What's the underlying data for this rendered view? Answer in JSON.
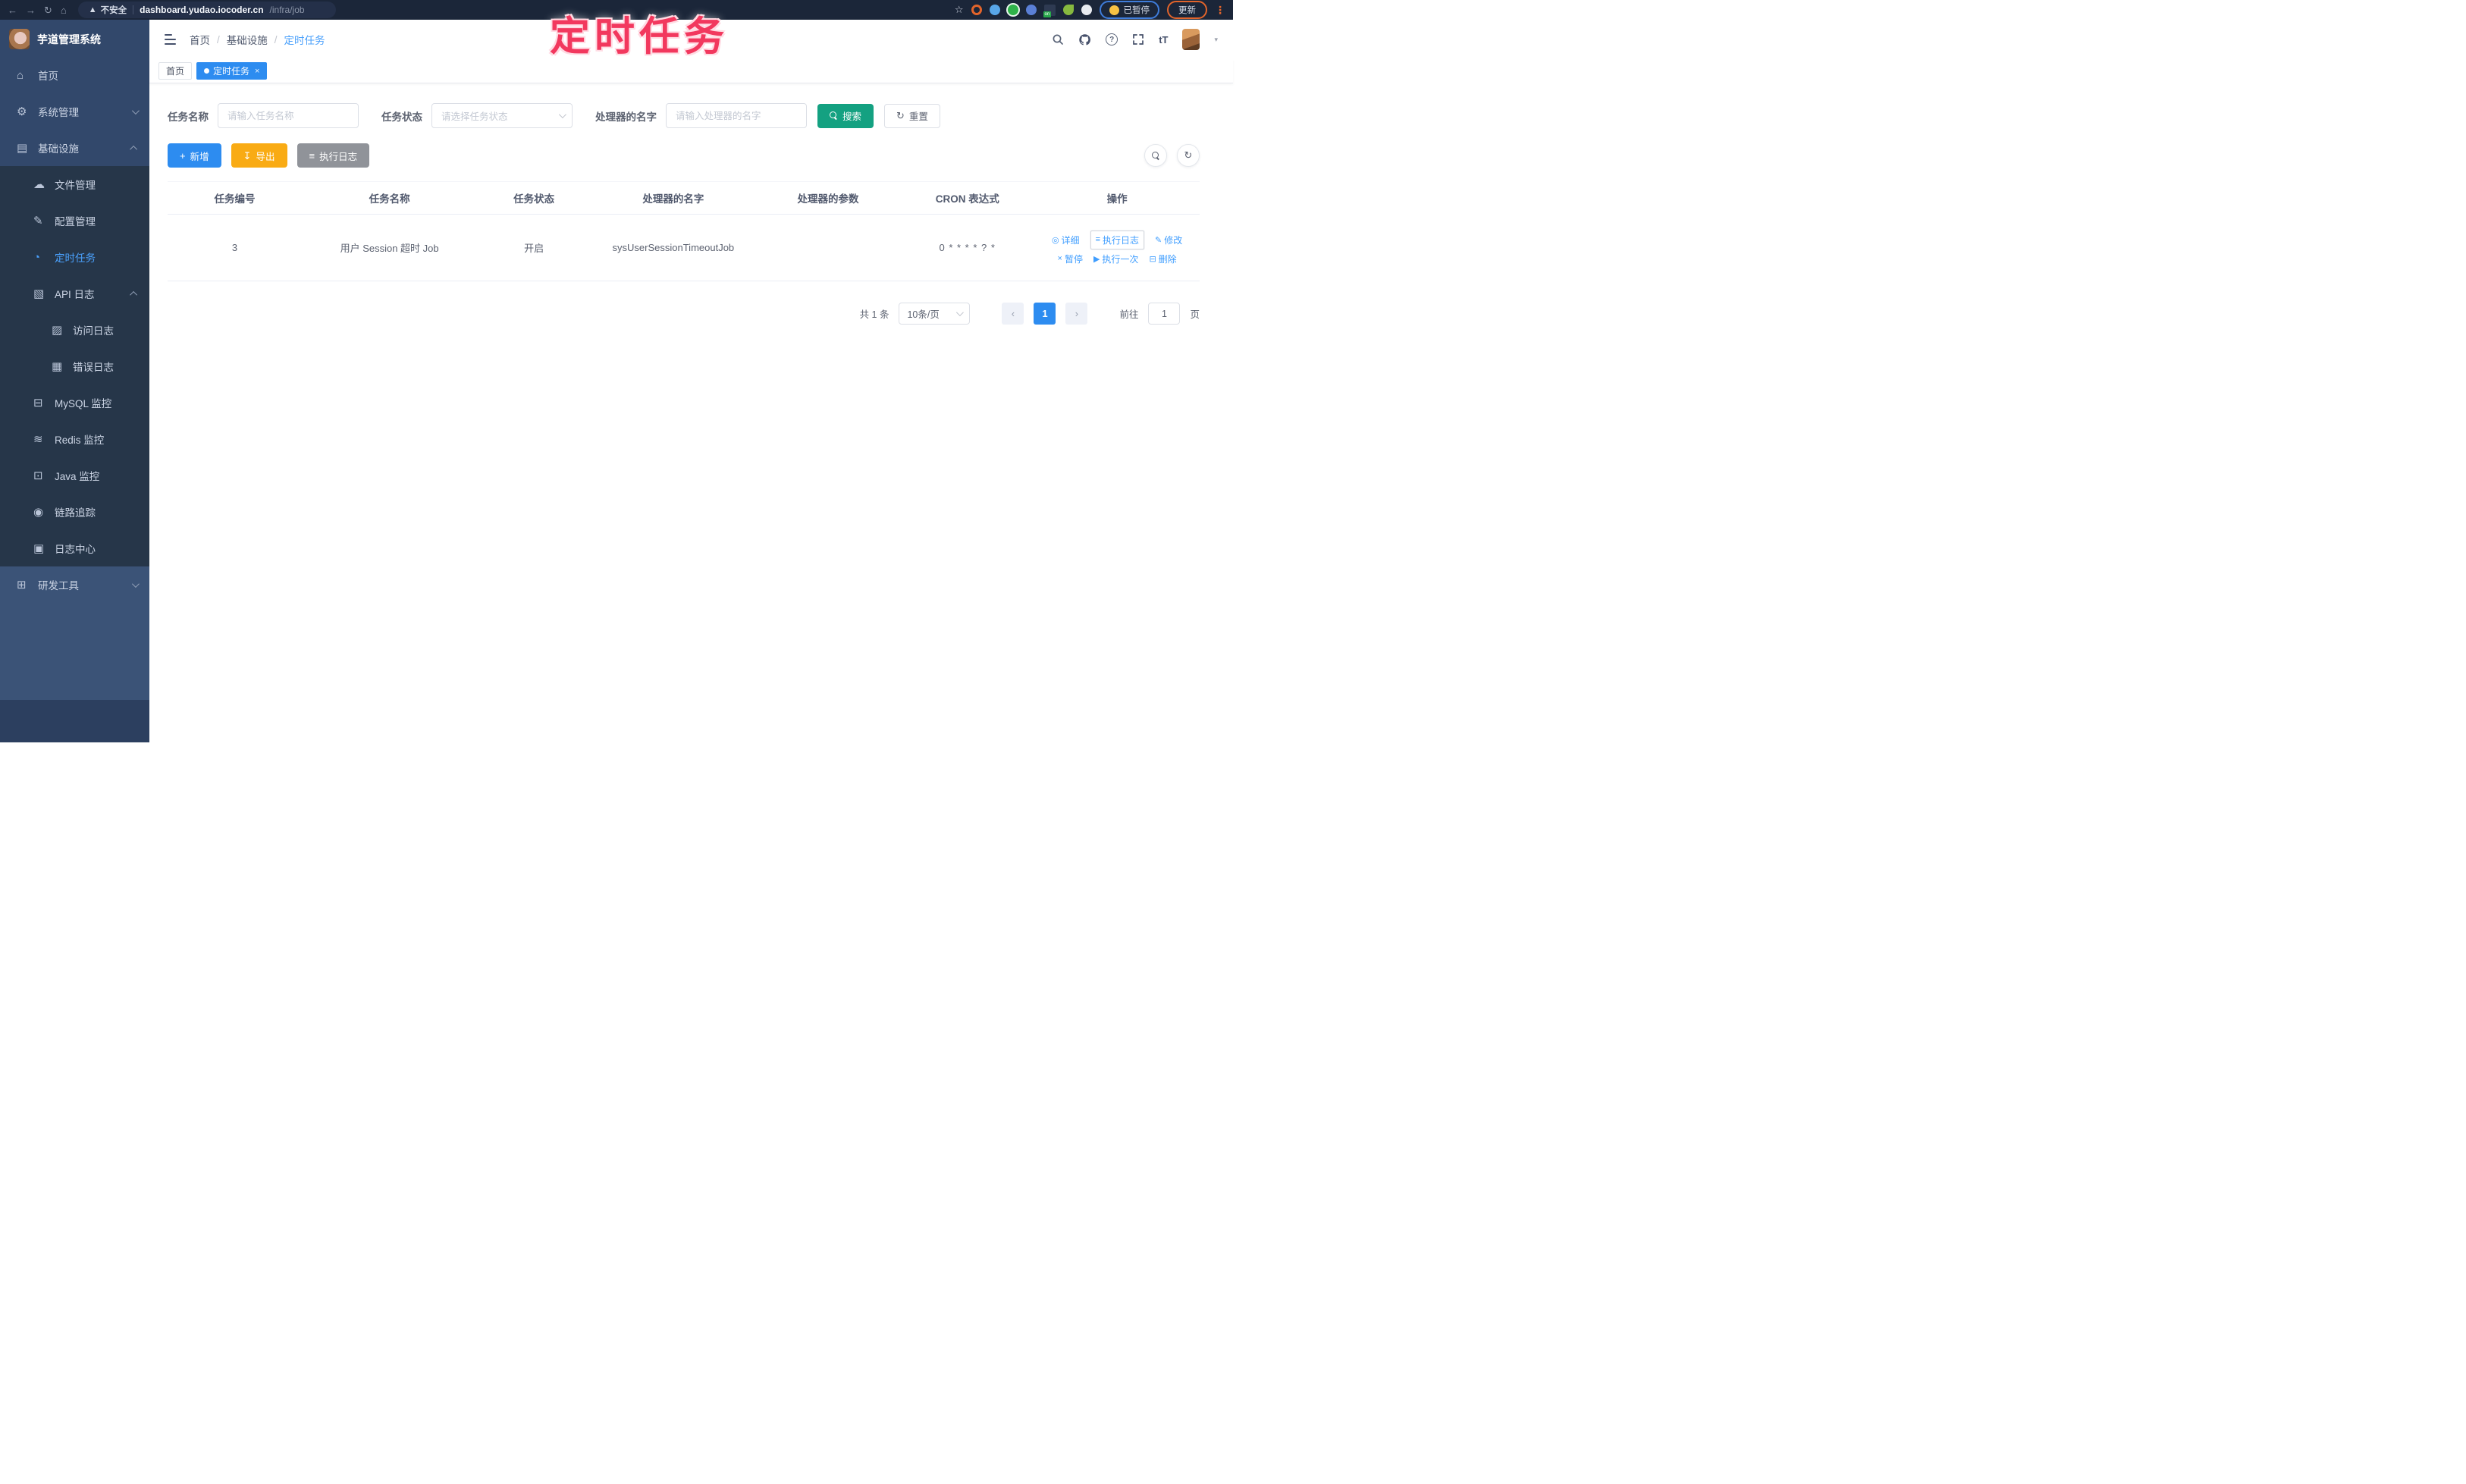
{
  "browser": {
    "security_label": "不安全",
    "url_domain": "dashboard.yudao.iocoder.cn",
    "url_path": "/infra/job",
    "profile_status": "已暂停",
    "update_label": "更新"
  },
  "annotation_text": "定时任务",
  "sidebar": {
    "app_title": "芋道管理系统",
    "items": [
      {
        "label": "首页",
        "icon": "home-icon"
      },
      {
        "label": "系统管理",
        "icon": "gear-icon",
        "chevron": "down"
      },
      {
        "label": "基础设施",
        "icon": "infrastructure-icon",
        "chevron": "up"
      },
      {
        "label": "文件管理",
        "icon": "file-cloud-icon"
      },
      {
        "label": "配置管理",
        "icon": "config-edit-icon"
      },
      {
        "label": "定时任务",
        "icon": "scheduled-job-icon",
        "active": true
      },
      {
        "label": "API 日志",
        "icon": "api-log-icon",
        "chevron": "up"
      },
      {
        "label": "访问日志",
        "icon": "access-log-icon"
      },
      {
        "label": "错误日志",
        "icon": "error-log-icon"
      },
      {
        "label": "MySQL 监控",
        "icon": "mysql-monitor-icon"
      },
      {
        "label": "Redis 监控",
        "icon": "redis-monitor-icon"
      },
      {
        "label": "Java 监控",
        "icon": "java-monitor-icon"
      },
      {
        "label": "链路追踪",
        "icon": "trace-icon"
      },
      {
        "label": "日志中心",
        "icon": "log-center-icon"
      },
      {
        "label": "研发工具",
        "icon": "devtools-icon",
        "chevron": "down"
      }
    ]
  },
  "header": {
    "breadcrumb": [
      "首页",
      "基础设施",
      "定时任务"
    ]
  },
  "tabs": [
    {
      "label": "首页",
      "active": false
    },
    {
      "label": "定时任务",
      "active": true
    }
  ],
  "filters": {
    "name_label": "任务名称",
    "name_placeholder": "请输入任务名称",
    "status_label": "任务状态",
    "status_placeholder": "请选择任务状态",
    "handler_label": "处理器的名字",
    "handler_placeholder": "请输入处理器的名字",
    "search_label": "搜索",
    "reset_label": "重置"
  },
  "toolbar": {
    "add_label": "新增",
    "export_label": "导出",
    "exec_log_label": "执行日志"
  },
  "table": {
    "headers": [
      "任务编号",
      "任务名称",
      "任务状态",
      "处理器的名字",
      "处理器的参数",
      "CRON 表达式",
      "操作"
    ],
    "rows": [
      {
        "id": "3",
        "name": "用户 Session 超时 Job",
        "status": "开启",
        "handler": "sysUserSessionTimeoutJob",
        "param": "",
        "cron": "0 * * * * ? *"
      }
    ],
    "actions": [
      "详细",
      "执行日志",
      "修改",
      "暂停",
      "执行一次",
      "删除"
    ]
  },
  "pagination": {
    "total": "共 1 条",
    "page_size": "10条/页",
    "current_page": "1",
    "goto_label": "前往",
    "goto_value": "1",
    "page_unit": "页"
  },
  "colors": {
    "primary_blue": "#2d8cf0",
    "link_blue": "#409eff",
    "search_teal": "#14a181",
    "export_yellow": "#f9ab14",
    "info_gray": "#909399",
    "annotation_red": "#f2385e",
    "sidebar_bg": "#32486b",
    "submenu_bg": "#263649",
    "browser_bar_bg": "#1b2639"
  }
}
